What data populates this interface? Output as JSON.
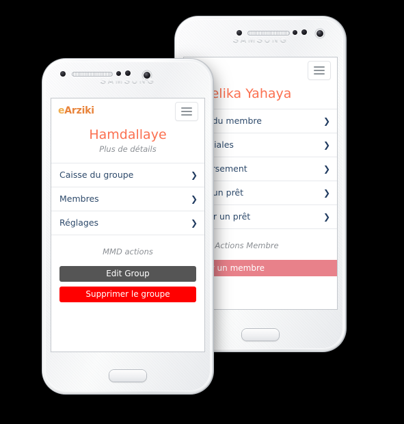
{
  "background_color": "#000000",
  "brand": {
    "device_label": "SAMSUNG",
    "logo_first": "e",
    "logo_rest": "Arziki",
    "logo_color_first": "#f0ad4e",
    "logo_color_rest": "#e8833a",
    "title_color": "#fb7050"
  },
  "front_phone": {
    "name": "group-details-screen",
    "navbar": {
      "logo_first": "e",
      "logo_rest": "Arziki",
      "menu_label": "Menu"
    },
    "page_title": "Hamdallaye",
    "page_subtitle": "Plus de détails",
    "list": [
      {
        "label": "Caisse du groupe",
        "chevron": "❯"
      },
      {
        "label": "Membres",
        "chevron": "❯"
      },
      {
        "label": "Réglages",
        "chevron": "❯"
      }
    ],
    "section_label": "MMD actions",
    "buttons": [
      {
        "label": "Edit Group",
        "color": "#555555",
        "name": "edit-group-button"
      },
      {
        "label": "Supprimer le groupe",
        "color": "#ff0000",
        "name": "delete-group-button"
      }
    ]
  },
  "back_phone": {
    "name": "member-details-screen",
    "navbar": {
      "logo_first": "e",
      "logo_rest": "Arziki",
      "menu_label": "Menu"
    },
    "page_title": "Zelika Yahaya",
    "list": [
      {
        "label": "Le compte du membre",
        "chevron": "❯"
      },
      {
        "label": "Actions Sociales",
        "chevron": "❯"
      },
      {
        "label": "Faire un versement",
        "chevron": "❯"
      },
      {
        "label": "Demander un prêt",
        "chevron": "❯"
      },
      {
        "label": "Rembourser un prêt",
        "chevron": "❯"
      }
    ],
    "section_label": "Actions Membre",
    "buttons": [
      {
        "label": "Supprimer un membre",
        "color": "#e8818a",
        "name": "delete-member-button"
      }
    ]
  }
}
